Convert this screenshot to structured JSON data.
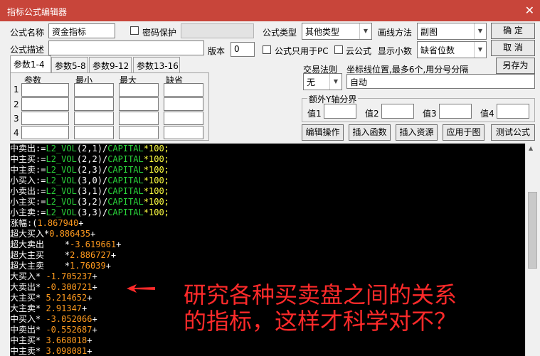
{
  "window": {
    "title": "指标公式编辑器",
    "close_label": "✕"
  },
  "form": {
    "name_label": "公式名称",
    "name_value": "资金指标",
    "password_label": "密码保护",
    "password_value": "",
    "type_label": "公式类型",
    "type_value": "其他类型",
    "draw_label": "画线方法",
    "draw_value": "副图",
    "desc_label": "公式描述",
    "desc_value": "",
    "version_label": "版本",
    "version_value": "0",
    "pc_only_label": "公式只用于PC",
    "cloud_label": "云公式",
    "decimals_label": "显示小数",
    "decimals_value": "缺省位数"
  },
  "buttons": {
    "ok": "确  定",
    "cancel": "取  消",
    "save_as": "另存为",
    "edit_ops": "编辑操作",
    "insert_func": "插入函数",
    "insert_res": "插入资源",
    "apply_chart": "应用于图",
    "test": "测试公式"
  },
  "tabs": [
    "参数1-4",
    "参数5-8",
    "参数9-12",
    "参数13-16"
  ],
  "params": {
    "headers": [
      "参数",
      "最小",
      "最大",
      "缺省"
    ],
    "rows": [
      "1",
      "2",
      "3",
      "4"
    ]
  },
  "trade_rule": {
    "label": "交易法则",
    "value": "无"
  },
  "coord": {
    "label": "坐标线位置,最多6个,用分号分隔",
    "value": "自动"
  },
  "yaxis": {
    "title": "额外Y轴分界",
    "labels": [
      "值1",
      "值2",
      "值3",
      "值4"
    ]
  },
  "code": [
    [
      {
        "t": "中卖出",
        "c": "w"
      },
      {
        "t": ":=",
        "c": "w"
      },
      {
        "t": "L2_VOL",
        "c": "g"
      },
      {
        "t": "(2,1)/",
        "c": "w"
      },
      {
        "t": "CAPITAL",
        "c": "g"
      },
      {
        "t": "*100;",
        "c": "y"
      }
    ],
    [
      {
        "t": "中主买",
        "c": "w"
      },
      {
        "t": ":=",
        "c": "w"
      },
      {
        "t": "L2_VOL",
        "c": "g"
      },
      {
        "t": "(2,2)/",
        "c": "w"
      },
      {
        "t": "CAPITAL",
        "c": "g"
      },
      {
        "t": "*100;",
        "c": "y"
      }
    ],
    [
      {
        "t": "中主卖",
        "c": "w"
      },
      {
        "t": ":=",
        "c": "w"
      },
      {
        "t": "L2_VOL",
        "c": "g"
      },
      {
        "t": "(2,3)/",
        "c": "w"
      },
      {
        "t": "CAPITAL",
        "c": "g"
      },
      {
        "t": "*100;",
        "c": "y"
      }
    ],
    [
      {
        "t": "小买入",
        "c": "w"
      },
      {
        "t": ":=",
        "c": "w"
      },
      {
        "t": "L2_VOL",
        "c": "g"
      },
      {
        "t": "(3,0)/",
        "c": "w"
      },
      {
        "t": "CAPITAL",
        "c": "g"
      },
      {
        "t": "*100;",
        "c": "y"
      }
    ],
    [
      {
        "t": "小卖出",
        "c": "w"
      },
      {
        "t": ":=",
        "c": "w"
      },
      {
        "t": "L2_VOL",
        "c": "g"
      },
      {
        "t": "(3,1)/",
        "c": "w"
      },
      {
        "t": "CAPITAL",
        "c": "g"
      },
      {
        "t": "*100;",
        "c": "y"
      }
    ],
    [
      {
        "t": "小主买",
        "c": "w"
      },
      {
        "t": ":=",
        "c": "w"
      },
      {
        "t": "L2_VOL",
        "c": "g"
      },
      {
        "t": "(3,2)/",
        "c": "w"
      },
      {
        "t": "CAPITAL",
        "c": "g"
      },
      {
        "t": "*100;",
        "c": "y"
      }
    ],
    [
      {
        "t": "小主卖",
        "c": "w"
      },
      {
        "t": ":=",
        "c": "w"
      },
      {
        "t": "L2_VOL",
        "c": "g"
      },
      {
        "t": "(3,3)/",
        "c": "w"
      },
      {
        "t": "CAPITAL",
        "c": "g"
      },
      {
        "t": "*100;",
        "c": "y"
      }
    ],
    [
      {
        "t": "涨幅:(",
        "c": "w"
      },
      {
        "t": "1.867940",
        "c": "o"
      },
      {
        "t": "+",
        "c": "w"
      }
    ],
    [
      {
        "t": "超大买入",
        "c": "w"
      },
      {
        "t": "*",
        "c": "w"
      },
      {
        "t": "0.886435",
        "c": "o"
      },
      {
        "t": "+",
        "c": "w"
      }
    ],
    [
      {
        "t": "超大卖出    *",
        "c": "w"
      },
      {
        "t": "-3.619661",
        "c": "o"
      },
      {
        "t": "+",
        "c": "w"
      }
    ],
    [
      {
        "t": "超大主买    *",
        "c": "w"
      },
      {
        "t": "2.886727",
        "c": "o"
      },
      {
        "t": "+",
        "c": "w"
      }
    ],
    [
      {
        "t": "超大主卖    *",
        "c": "w"
      },
      {
        "t": "1.76039",
        "c": "o"
      },
      {
        "t": "+",
        "c": "w"
      }
    ],
    [
      {
        "t": "大买入* ",
        "c": "w"
      },
      {
        "t": "-1.705237",
        "c": "o"
      },
      {
        "t": "+",
        "c": "w"
      }
    ],
    [
      {
        "t": "大卖出* ",
        "c": "w"
      },
      {
        "t": "-0.300721",
        "c": "o"
      },
      {
        "t": "+",
        "c": "w"
      }
    ],
    [
      {
        "t": "大主买* ",
        "c": "w"
      },
      {
        "t": "5.214652",
        "c": "o"
      },
      {
        "t": "+",
        "c": "w"
      }
    ],
    [
      {
        "t": "大主卖* ",
        "c": "w"
      },
      {
        "t": "2.91347",
        "c": "o"
      },
      {
        "t": "+",
        "c": "w"
      }
    ],
    [
      {
        "t": "中买入* ",
        "c": "w"
      },
      {
        "t": "-3.052066",
        "c": "o"
      },
      {
        "t": "+",
        "c": "w"
      }
    ],
    [
      {
        "t": "中卖出* ",
        "c": "w"
      },
      {
        "t": "-0.552687",
        "c": "o"
      },
      {
        "t": "+",
        "c": "w"
      }
    ],
    [
      {
        "t": "中主买* ",
        "c": "w"
      },
      {
        "t": "3.668018",
        "c": "o"
      },
      {
        "t": "+",
        "c": "w"
      }
    ],
    [
      {
        "t": "中主卖* ",
        "c": "w"
      },
      {
        "t": "3.098081",
        "c": "o"
      },
      {
        "t": "+",
        "c": "w"
      }
    ]
  ],
  "annotation": {
    "line1": "研究各种买卖盘之间的关系",
    "line2": "的指标，这样才科学对不？",
    "color": "#ff2a2a"
  }
}
